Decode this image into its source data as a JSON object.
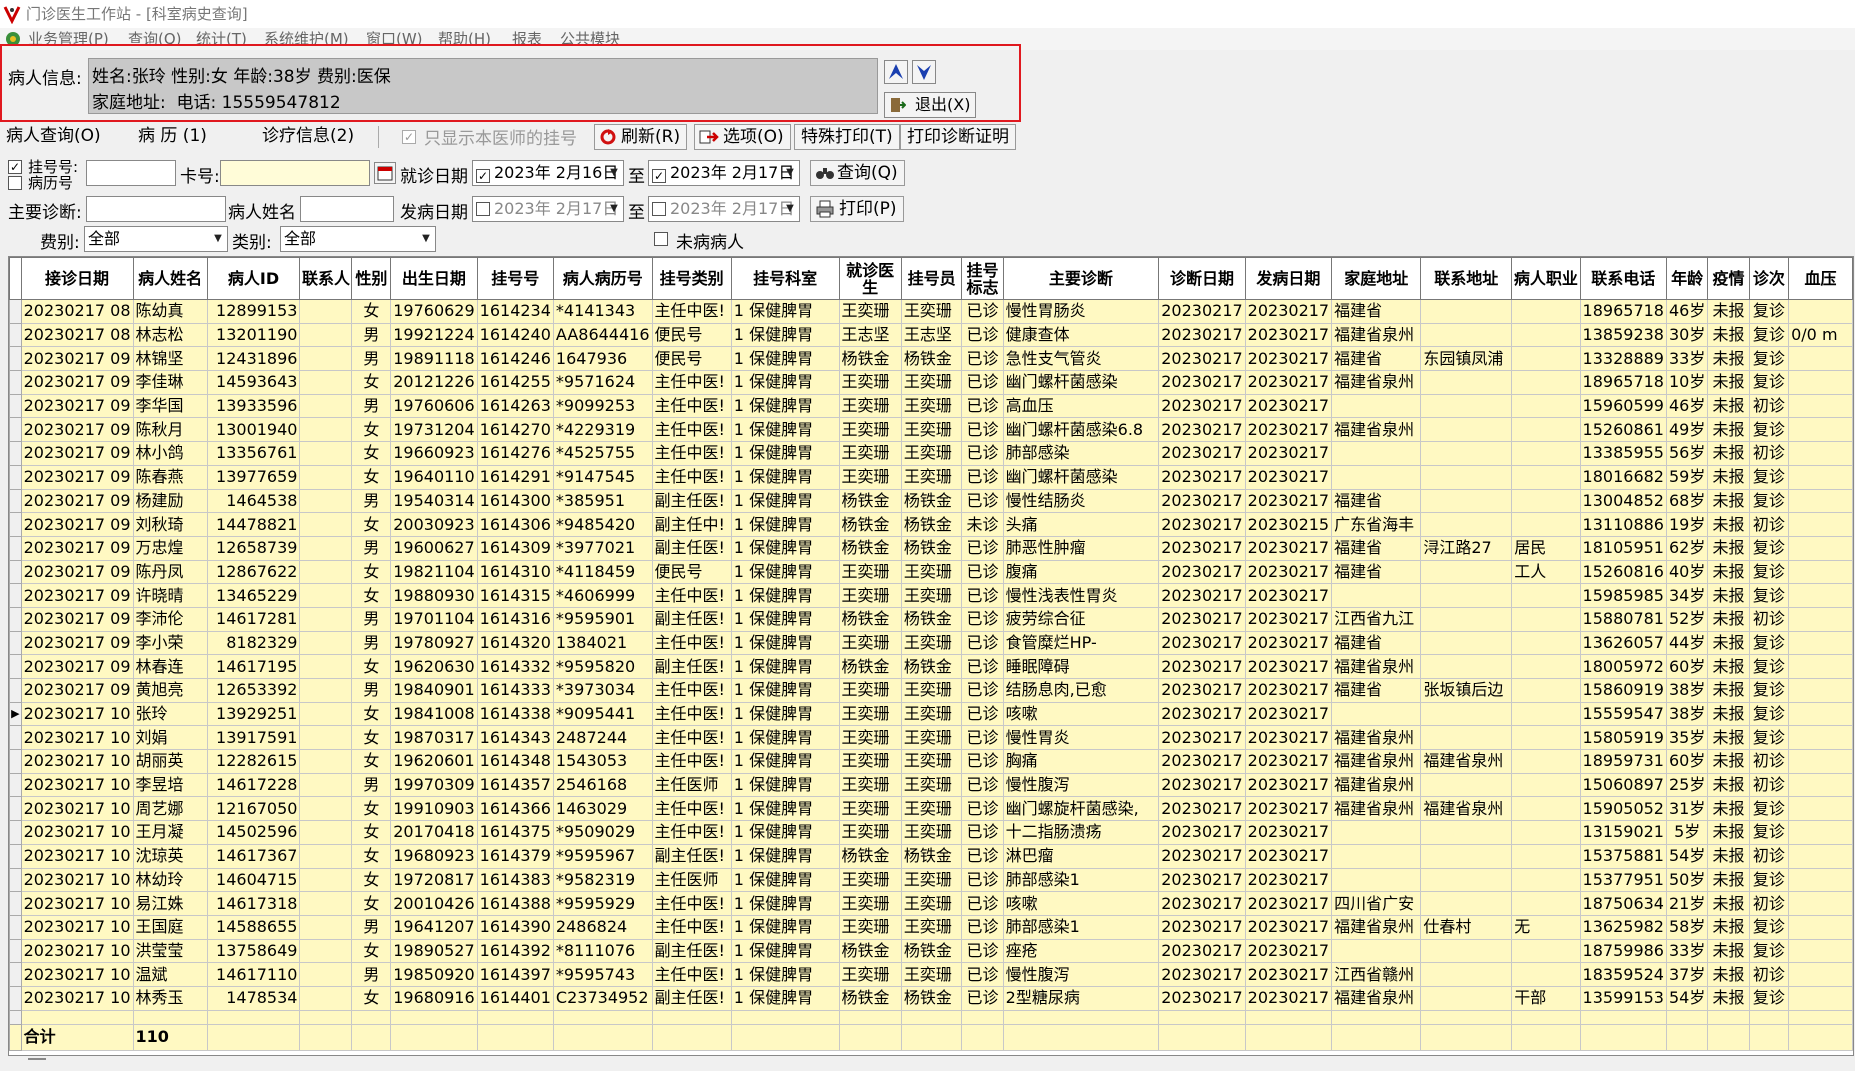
{
  "window": {
    "title": "门诊医生工作站 - [科室病史查询]"
  },
  "menu": {
    "items": [
      "业务管理(P)",
      "查询(Q)",
      "统计(T)",
      "系统维护(M)",
      "窗口(W)",
      "帮助(H)",
      "报表",
      "公共模块"
    ]
  },
  "patient": {
    "label": "病人信息:",
    "line1": "姓名:张玲 性别:女 年龄:38岁 费别:医保",
    "line2": "家庭地址:  电话: 15559547812",
    "exit_label": "退出(X)"
  },
  "toolbar": {
    "tab_query": "病人查询(O)",
    "tab_history": "病 历 (1)",
    "tab_diag": "诊疗信息(2)",
    "only_mine_label": "只显示本医师的挂号",
    "refresh_label": "刷新(R)",
    "options_label": "选项(O)",
    "special_print_label": "特殊打印(T)",
    "print_cert_label": "打印诊断证明"
  },
  "filters": {
    "reg_no_label": "挂号号:",
    "record_no_label": "病历号",
    "card_label": "卡号:",
    "visit_date_label": "就诊日期",
    "visit_from": "2023年 2月16日",
    "to_label": "至",
    "visit_to": "2023年 2月17日",
    "query_label": "查询(Q)",
    "diag_label": "主要诊断:",
    "name_label": "病人姓名",
    "onset_label": "发病日期",
    "onset_from": "2023年 2月17日",
    "onset_to": "2023年 2月17日",
    "print_label": "打印(P)",
    "fee_label": "费别:",
    "fee_value": "全部",
    "type_label": "类别:",
    "type_value": "全部",
    "unvisited_label": "未病病人"
  },
  "table": {
    "headers": [
      "接诊日期",
      "病人姓名",
      "病人ID",
      "联系人",
      "性别",
      "出生日期",
      "挂号号",
      "病人病历号",
      "挂号类别",
      "挂号科室",
      "就诊医生",
      "挂号员",
      "挂号标志",
      "主要诊断",
      "诊断日期",
      "发病日期",
      "家庭地址",
      "联系地址",
      "病人职业",
      "联系电话",
      "年龄",
      "疫情",
      "诊次",
      "血压"
    ],
    "rows": [
      [
        "20230217 08",
        "陈幼真",
        "12899153",
        "",
        "女",
        "19760629",
        "1614234",
        "*4141343",
        "主任中医!",
        "1 保健脾胃",
        "王奕珊",
        "王奕珊",
        "已诊",
        "慢性胃肠炎",
        "20230217",
        "20230217",
        "福建省",
        "",
        "",
        "18965718",
        "46岁",
        "未报",
        "复诊",
        ""
      ],
      [
        "20230217 08",
        "林志松",
        "13201190",
        "",
        "男",
        "19921224",
        "1614240",
        "AA8644416",
        "便民号",
        "1 保健脾胃",
        "王志坚",
        "王志坚",
        "已诊",
        "健康查体",
        "20230217",
        "20230217",
        "福建省泉州",
        "",
        "",
        "13859238",
        "30岁",
        "未报",
        "复诊",
        "0/0 m"
      ],
      [
        "20230217 09",
        "林锦坚",
        "12431896",
        "",
        "男",
        "19891118",
        "1614246",
        "1647936",
        "便民号",
        "1 保健脾胃",
        "杨铁金",
        "杨铁金",
        "已诊",
        "急性支气管炎",
        "20230217",
        "20230217",
        "福建省",
        "东园镇凤浦",
        "",
        "13328889",
        "33岁",
        "未报",
        "复诊",
        ""
      ],
      [
        "20230217 09",
        "李佳琳",
        "14593643",
        "",
        "女",
        "20121226",
        "1614255",
        "*9571624",
        "主任中医!",
        "1 保健脾胃",
        "王奕珊",
        "王奕珊",
        "已诊",
        "幽门螺杆菌感染",
        "20230217",
        "20230217",
        "福建省泉州",
        "",
        "",
        "18965718",
        "10岁",
        "未报",
        "复诊",
        ""
      ],
      [
        "20230217 09",
        "李华国",
        "13933596",
        "",
        "男",
        "19760606",
        "1614263",
        "*9099253",
        "主任中医!",
        "1 保健脾胃",
        "王奕珊",
        "王奕珊",
        "已诊",
        "高血压",
        "20230217",
        "20230217",
        "",
        "",
        "",
        "15960599",
        "46岁",
        "未报",
        "初诊",
        ""
      ],
      [
        "20230217 09",
        "陈秋月",
        "13001940",
        "",
        "女",
        "19731204",
        "1614270",
        "*4229319",
        "主任中医!",
        "1 保健脾胃",
        "王奕珊",
        "王奕珊",
        "已诊",
        "幽门螺杆菌感染6.8",
        "20230217",
        "20230217",
        "福建省泉州",
        "",
        "",
        "15260861",
        "49岁",
        "未报",
        "复诊",
        ""
      ],
      [
        "20230217 09",
        "林小鸽",
        "13356761",
        "",
        "女",
        "19660923",
        "1614276",
        "*4525755",
        "主任中医!",
        "1 保健脾胃",
        "王奕珊",
        "王奕珊",
        "已诊",
        "肺部感染",
        "20230217",
        "20230217",
        "",
        "",
        "",
        "13385955",
        "56岁",
        "未报",
        "初诊",
        ""
      ],
      [
        "20230217 09",
        "陈春燕",
        "13977659",
        "",
        "女",
        "19640110",
        "1614291",
        "*9147545",
        "主任中医!",
        "1 保健脾胃",
        "王奕珊",
        "王奕珊",
        "已诊",
        "幽门螺杆菌感染",
        "20230217",
        "20230217",
        "",
        "",
        "",
        "18016682",
        "59岁",
        "未报",
        "复诊",
        ""
      ],
      [
        "20230217 09",
        "杨建励",
        "1464538",
        "",
        "男",
        "19540314",
        "1614300",
        "*385951",
        "副主任医!",
        "1 保健脾胃",
        "杨铁金",
        "杨铁金",
        "已诊",
        "慢性结肠炎",
        "20230217",
        "20230217",
        "福建省",
        "",
        "",
        "13004852",
        "68岁",
        "未报",
        "复诊",
        ""
      ],
      [
        "20230217 09",
        "刘秋琦",
        "14478821",
        "",
        "女",
        "20030923",
        "1614306",
        "*9485420",
        "副主任中!",
        "1 保健脾胃",
        "杨铁金",
        "杨铁金",
        "未诊",
        "头痛",
        "20230217",
        "20230215",
        "广东省海丰",
        "",
        "",
        "13110886",
        "19岁",
        "未报",
        "初诊",
        ""
      ],
      [
        "20230217 09",
        "万忠煌",
        "12658739",
        "",
        "男",
        "19600627",
        "1614309",
        "*3977021",
        "副主任医!",
        "1 保健脾胃",
        "杨铁金",
        "杨铁金",
        "已诊",
        "肺恶性肿瘤",
        "20230217",
        "20230217",
        "福建省",
        "浔江路27",
        "居民",
        "18105951",
        "62岁",
        "未报",
        "复诊",
        ""
      ],
      [
        "20230217 09",
        "陈丹凤",
        "12867622",
        "",
        "女",
        "19821104",
        "1614310",
        "*4118459",
        "便民号",
        "1 保健脾胃",
        "王奕珊",
        "王奕珊",
        "已诊",
        "腹痛",
        "20230217",
        "20230217",
        "福建省",
        "",
        "工人",
        "15260816",
        "40岁",
        "未报",
        "复诊",
        ""
      ],
      [
        "20230217 09",
        "许晓晴",
        "13465229",
        "",
        "女",
        "19880930",
        "1614315",
        "*4606999",
        "主任中医!",
        "1 保健脾胃",
        "王奕珊",
        "王奕珊",
        "已诊",
        "慢性浅表性胃炎",
        "20230217",
        "20230217",
        "",
        "",
        "",
        "15985985",
        "34岁",
        "未报",
        "复诊",
        ""
      ],
      [
        "20230217 09",
        "李沛伦",
        "14617281",
        "",
        "男",
        "19701104",
        "1614316",
        "*9595901",
        "副主任医!",
        "1 保健脾胃",
        "杨铁金",
        "杨铁金",
        "已诊",
        "疲劳综合征",
        "20230217",
        "20230217",
        "江西省九江",
        "",
        "",
        "15880781",
        "52岁",
        "未报",
        "初诊",
        ""
      ],
      [
        "20230217 09",
        "李小荣",
        "8182329",
        "",
        "男",
        "19780927",
        "1614320",
        "1384021",
        "主任中医!",
        "1 保健脾胃",
        "王奕珊",
        "王奕珊",
        "已诊",
        "食管糜烂HP-",
        "20230217",
        "20230217",
        "福建省",
        "",
        "",
        "13626057",
        "44岁",
        "未报",
        "复诊",
        ""
      ],
      [
        "20230217 09",
        "林春连",
        "14617195",
        "",
        "女",
        "19620630",
        "1614332",
        "*9595820",
        "副主任医!",
        "1 保健脾胃",
        "杨铁金",
        "杨铁金",
        "已诊",
        "睡眠障碍",
        "20230217",
        "20230217",
        "福建省泉州",
        "",
        "",
        "18005972",
        "60岁",
        "未报",
        "复诊",
        ""
      ],
      [
        "20230217 09",
        "黄旭亮",
        "12653392",
        "",
        "男",
        "19840901",
        "1614333",
        "*3973034",
        "主任中医!",
        "1 保健脾胃",
        "王奕珊",
        "王奕珊",
        "已诊",
        "结肠息肉,已愈",
        "20230217",
        "20230217",
        "福建省",
        "张坂镇后边",
        "",
        "15860919",
        "38岁",
        "未报",
        "复诊",
        ""
      ],
      [
        "20230217 10",
        "张玲",
        "13929251",
        "",
        "女",
        "19841008",
        "1614338",
        "*9095441",
        "主任中医!",
        "1 保健脾胃",
        "王奕珊",
        "王奕珊",
        "已诊",
        "咳嗽",
        "20230217",
        "20230217",
        "",
        "",
        "",
        "15559547",
        "38岁",
        "未报",
        "复诊",
        ""
      ],
      [
        "20230217 10",
        "刘娟",
        "13917591",
        "",
        "女",
        "19870317",
        "1614343",
        "2487244",
        "主任中医!",
        "1 保健脾胃",
        "王奕珊",
        "王奕珊",
        "已诊",
        "慢性胃炎",
        "20230217",
        "20230217",
        "福建省泉州",
        "",
        "",
        "15805919",
        "35岁",
        "未报",
        "复诊",
        ""
      ],
      [
        "20230217 10",
        "胡丽英",
        "12282615",
        "",
        "女",
        "19620601",
        "1614348",
        "1543053",
        "主任中医!",
        "1 保健脾胃",
        "王奕珊",
        "王奕珊",
        "已诊",
        "胸痛",
        "20230217",
        "20230217",
        "福建省泉州",
        "福建省泉州",
        "",
        "18959731",
        "60岁",
        "未报",
        "初诊",
        ""
      ],
      [
        "20230217 10",
        "李昱培",
        "14617228",
        "",
        "男",
        "19970309",
        "1614357",
        "2546168",
        "主任医师",
        "1 保健脾胃",
        "王奕珊",
        "王奕珊",
        "已诊",
        "慢性腹泻",
        "20230217",
        "20230217",
        "福建省泉州",
        "",
        "",
        "15060897",
        "25岁",
        "未报",
        "初诊",
        ""
      ],
      [
        "20230217 10",
        "周艺娜",
        "12167050",
        "",
        "女",
        "19910903",
        "1614366",
        "1463029",
        "主任中医!",
        "1 保健脾胃",
        "王奕珊",
        "王奕珊",
        "已诊",
        "幽门螺旋杆菌感染,",
        "20230217",
        "20230217",
        "福建省泉州",
        "福建省泉州",
        "",
        "15905052",
        "31岁",
        "未报",
        "复诊",
        ""
      ],
      [
        "20230217 10",
        "王月凝",
        "14502596",
        "",
        "女",
        "20170418",
        "1614375",
        "*9509029",
        "主任中医!",
        "1 保健脾胃",
        "王奕珊",
        "王奕珊",
        "已诊",
        "十二指肠溃疡",
        "20230217",
        "20230217",
        "",
        "",
        "",
        "13159021",
        "5岁",
        "未报",
        "复诊",
        ""
      ],
      [
        "20230217 10",
        "沈琼英",
        "14617367",
        "",
        "女",
        "19680923",
        "1614379",
        "*9595967",
        "副主任医!",
        "1 保健脾胃",
        "杨铁金",
        "杨铁金",
        "已诊",
        "淋巴瘤",
        "20230217",
        "20230217",
        "",
        "",
        "",
        "15375881",
        "54岁",
        "未报",
        "初诊",
        ""
      ],
      [
        "20230217 10",
        "林幼玲",
        "14604715",
        "",
        "女",
        "19720817",
        "1614383",
        "*9582319",
        "主任医师",
        "1 保健脾胃",
        "王奕珊",
        "王奕珊",
        "已诊",
        "肺部感染1",
        "20230217",
        "20230217",
        "",
        "",
        "",
        "15377951",
        "50岁",
        "未报",
        "复诊",
        ""
      ],
      [
        "20230217 10",
        "易江姝",
        "14617318",
        "",
        "女",
        "20010426",
        "1614388",
        "*9595929",
        "主任中医!",
        "1 保健脾胃",
        "王奕珊",
        "王奕珊",
        "已诊",
        "咳嗽",
        "20230217",
        "20230217",
        "四川省广安",
        "",
        "",
        "18750634",
        "21岁",
        "未报",
        "初诊",
        ""
      ],
      [
        "20230217 10",
        "王国庭",
        "14588655",
        "",
        "男",
        "19641207",
        "1614390",
        "2486824",
        "主任中医!",
        "1 保健脾胃",
        "王奕珊",
        "王奕珊",
        "已诊",
        "肺部感染1",
        "20230217",
        "20230217",
        "福建省泉州",
        "仕春村",
        "无",
        "13625982",
        "58岁",
        "未报",
        "复诊",
        ""
      ],
      [
        "20230217 10",
        "洪莹莹",
        "13758649",
        "",
        "女",
        "19890527",
        "1614392",
        "*8111076",
        "副主任医!",
        "1 保健脾胃",
        "杨铁金",
        "杨铁金",
        "已诊",
        "痤疮",
        "20230217",
        "20230217",
        "",
        "",
        "",
        "18759986",
        "33岁",
        "未报",
        "复诊",
        ""
      ],
      [
        "20230217 10",
        "温斌",
        "14617110",
        "",
        "男",
        "19850920",
        "1614397",
        "*9595743",
        "主任中医!",
        "1 保健脾胃",
        "王奕珊",
        "王奕珊",
        "已诊",
        "慢性腹泻",
        "20230217",
        "20230217",
        "江西省赣州",
        "",
        "",
        "18359524",
        "37岁",
        "未报",
        "初诊",
        ""
      ],
      [
        "20230217 10",
        "林秀玉",
        "1478534",
        "",
        "女",
        "19680916",
        "1614401",
        "C23734952",
        "副主任医!",
        "1 保健脾胃",
        "杨铁金",
        "杨铁金",
        "已诊",
        "2型糖尿病",
        "20230217",
        "20230217",
        "福建省泉州",
        "",
        "干部",
        "13599153",
        "54岁",
        "未报",
        "复诊",
        ""
      ]
    ],
    "current_row_index": 17,
    "total_label": "合计",
    "total_value": "110"
  },
  "colors": {
    "grid_row_bg": "#fff9c2",
    "highlight_frame": "#e0191f",
    "patient_box_bg": "#c8c8c8"
  }
}
